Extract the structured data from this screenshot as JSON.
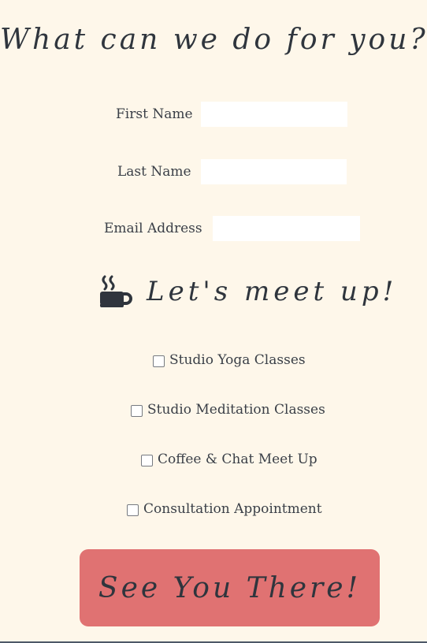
{
  "title": "What can we do for you?",
  "form": {
    "first_name_label": "First Name",
    "first_name_value": "",
    "last_name_label": "Last Name",
    "last_name_value": "",
    "email_label": "Email Address",
    "email_value": ""
  },
  "meetup": {
    "heading": "Let's meet up!",
    "icon": "coffee-cup-icon",
    "options": [
      {
        "label": "Studio Yoga Classes",
        "checked": false
      },
      {
        "label": "Studio Meditation Classes",
        "checked": false
      },
      {
        "label": "Coffee & Chat Meet Up",
        "checked": false
      },
      {
        "label": "Consultation Appointment",
        "checked": false
      }
    ]
  },
  "submit_label": "See You There!",
  "colors": {
    "background": "#fef7ea",
    "button": "#e07272",
    "text": "#3a3f47",
    "input": "#ffffff"
  }
}
